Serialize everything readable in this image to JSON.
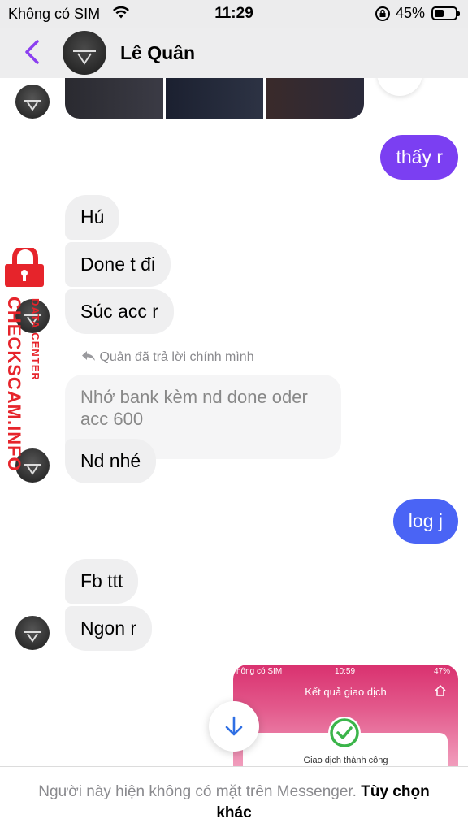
{
  "status_bar": {
    "carrier": "Không có SIM",
    "time": "11:29",
    "battery": "45%"
  },
  "header": {
    "name": "Lê Quân"
  },
  "messages": {
    "m1": "thấy r",
    "m2": "Hú",
    "m3": "Done t đi",
    "m4": "Súc acc r",
    "reply_label": "Quân đã trả lời chính mình",
    "reply_quote": "Nhớ bank kèm nd done oder acc 600",
    "m5": "Nd nhé",
    "m6": "log j",
    "m7": "Fb ttt",
    "m8": "Ngon r"
  },
  "attachment": {
    "status_left": "hông có SIM",
    "status_time": "10:59",
    "status_battery": "47%",
    "title": "Kết quả giao dịch",
    "success": "Giao dịch thành công"
  },
  "bottom_bar": {
    "notice": "Người này hiện không có mặt trên Messenger.",
    "action": "Tùy chọn khác"
  },
  "watermark": {
    "main": "CHECKSCAM.INFO",
    "sub": "DATA CENTER"
  },
  "colors": {
    "accent_purple": "#8b3ff0",
    "bubble_purple": "#7b3ff2",
    "bubble_blue": "#4a64f5",
    "incoming_gray": "#efeff0",
    "watermark_red": "#e6242b"
  },
  "icons": {
    "back": "chevron-left-icon",
    "wifi": "wifi-icon",
    "orientation_lock": "rotation-lock-icon",
    "reply": "reply-arrow-icon",
    "scroll_down": "arrow-down-icon",
    "success": "check-circle-icon"
  }
}
